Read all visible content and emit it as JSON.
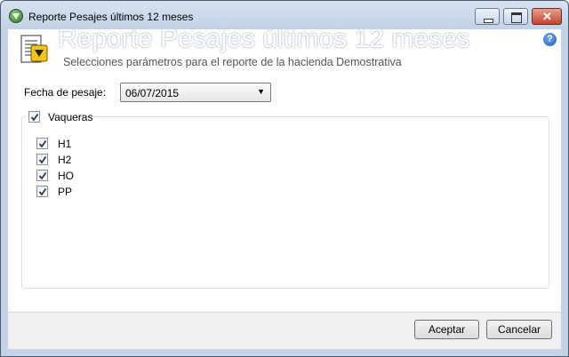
{
  "window": {
    "title": "Reporte Pesajes últimos 12 meses"
  },
  "header": {
    "title": "Reporte Pesajes últimos 12 meses",
    "subtitle": "Selecciones parámetros para el reporte de la hacienda Demostrativa",
    "help_icon": "?"
  },
  "form": {
    "date_label": "Fecha de pesaje:",
    "date_value": "06/07/2015"
  },
  "group": {
    "label": "Vaqueras",
    "checked": true,
    "items": [
      {
        "label": "H1",
        "checked": true
      },
      {
        "label": "H2",
        "checked": true
      },
      {
        "label": "HO",
        "checked": true
      },
      {
        "label": "PP",
        "checked": true
      }
    ]
  },
  "footer": {
    "accept_label": "Aceptar",
    "cancel_label": "Cancelar"
  }
}
